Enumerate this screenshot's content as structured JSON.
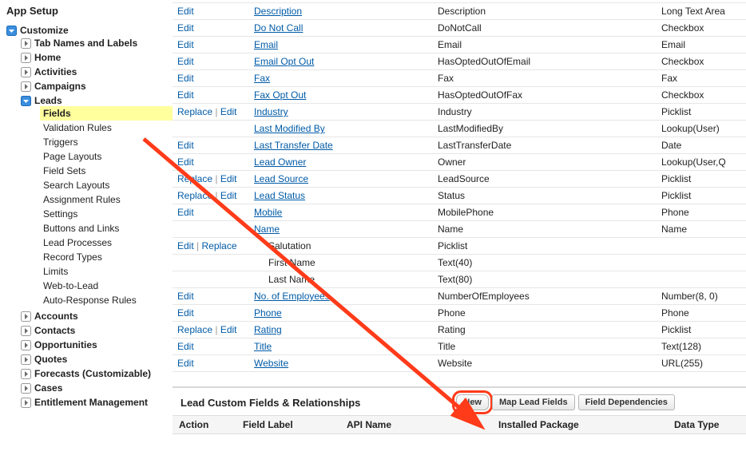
{
  "sidebar": {
    "title": "App Setup",
    "customize": {
      "label": "Customize",
      "items": [
        {
          "label": "Tab Names and Labels",
          "expanded": false,
          "children": []
        },
        {
          "label": "Home",
          "expanded": false,
          "children": []
        },
        {
          "label": "Activities",
          "expanded": false,
          "children": []
        },
        {
          "label": "Campaigns",
          "expanded": false,
          "children": []
        },
        {
          "label": "Leads",
          "expanded": true,
          "children": [
            {
              "label": "Fields",
              "active": true
            },
            {
              "label": "Validation Rules"
            },
            {
              "label": "Triggers"
            },
            {
              "label": "Page Layouts"
            },
            {
              "label": "Field Sets"
            },
            {
              "label": "Search Layouts"
            },
            {
              "label": "Assignment Rules"
            },
            {
              "label": "Settings"
            },
            {
              "label": "Buttons and Links"
            },
            {
              "label": "Lead Processes"
            },
            {
              "label": "Record Types"
            },
            {
              "label": "Limits"
            },
            {
              "label": "Web-to-Lead"
            },
            {
              "label": "Auto-Response Rules"
            }
          ]
        },
        {
          "label": "Accounts",
          "expanded": false,
          "children": []
        },
        {
          "label": "Contacts",
          "expanded": false,
          "children": []
        },
        {
          "label": "Opportunities",
          "expanded": false,
          "children": []
        },
        {
          "label": "Quotes",
          "expanded": false,
          "children": []
        },
        {
          "label": "Forecasts (Customizable)",
          "expanded": false,
          "children": []
        },
        {
          "label": "Cases",
          "expanded": false,
          "children": []
        },
        {
          "label": "Entitlement Management",
          "expanded": false,
          "children": []
        }
      ]
    }
  },
  "fields_table": {
    "rows": [
      {
        "actions": [
          "Edit"
        ],
        "label": "Description",
        "api": "Description",
        "type": "Long Text Area"
      },
      {
        "actions": [
          "Edit"
        ],
        "label": "Do Not Call",
        "api": "DoNotCall",
        "type": "Checkbox"
      },
      {
        "actions": [
          "Edit"
        ],
        "label": "Email",
        "api": "Email",
        "type": "Email"
      },
      {
        "actions": [
          "Edit"
        ],
        "label": "Email Opt Out",
        "api": "HasOptedOutOfEmail",
        "type": "Checkbox"
      },
      {
        "actions": [
          "Edit"
        ],
        "label": "Fax",
        "api": "Fax",
        "type": "Fax"
      },
      {
        "actions": [
          "Edit"
        ],
        "label": "Fax Opt Out",
        "api": "HasOptedOutOfFax",
        "type": "Checkbox"
      },
      {
        "actions": [
          "Replace",
          "Edit"
        ],
        "label": "Industry",
        "api": "Industry",
        "type": "Picklist"
      },
      {
        "actions": [],
        "label": "Last Modified By",
        "api": "LastModifiedBy",
        "type": "Lookup(User)"
      },
      {
        "actions": [
          "Edit"
        ],
        "label": "Last Transfer Date",
        "api": "LastTransferDate",
        "type": "Date"
      },
      {
        "actions": [
          "Edit"
        ],
        "label": "Lead Owner",
        "api": "Owner",
        "type": "Lookup(User,Q"
      },
      {
        "actions": [
          "Replace",
          "Edit"
        ],
        "label": "Lead Source",
        "api": "LeadSource",
        "type": "Picklist"
      },
      {
        "actions": [
          "Replace",
          "Edit"
        ],
        "label": "Lead Status",
        "api": "Status",
        "type": "Picklist"
      },
      {
        "actions": [
          "Edit"
        ],
        "label": "Mobile",
        "api": "MobilePhone",
        "type": "Phone"
      },
      {
        "actions": [],
        "label": "Name",
        "api": "Name",
        "type": "Name"
      },
      {
        "actions": [
          "Edit",
          "Replace"
        ],
        "label": "Salutation",
        "api": "Picklist",
        "type": "",
        "indent": true,
        "nolink": true
      },
      {
        "actions": [],
        "label": "First Name",
        "api": "Text(40)",
        "type": "",
        "indent": true,
        "nolink": true
      },
      {
        "actions": [],
        "label": "Last Name",
        "api": "Text(80)",
        "type": "",
        "indent": true,
        "nolink": true
      },
      {
        "actions": [
          "Edit"
        ],
        "label": "No. of Employees",
        "api": "NumberOfEmployees",
        "type": "Number(8, 0)"
      },
      {
        "actions": [
          "Edit"
        ],
        "label": "Phone",
        "api": "Phone",
        "type": "Phone"
      },
      {
        "actions": [
          "Replace",
          "Edit"
        ],
        "label": "Rating",
        "api": "Rating",
        "type": "Picklist"
      },
      {
        "actions": [
          "Edit"
        ],
        "label": "Title",
        "api": "Title",
        "type": "Text(128)"
      },
      {
        "actions": [
          "Edit"
        ],
        "label": "Website",
        "api": "Website",
        "type": "URL(255)"
      }
    ]
  },
  "custom_section": {
    "title": "Lead Custom Fields & Relationships",
    "buttons": {
      "new": "New",
      "map": "Map Lead Fields",
      "deps": "Field Dependencies"
    },
    "columns": {
      "action": "Action",
      "field_label": "Field Label",
      "api_name": "API Name",
      "installed_pkg": "Installed Package",
      "data_type": "Data Type"
    }
  }
}
